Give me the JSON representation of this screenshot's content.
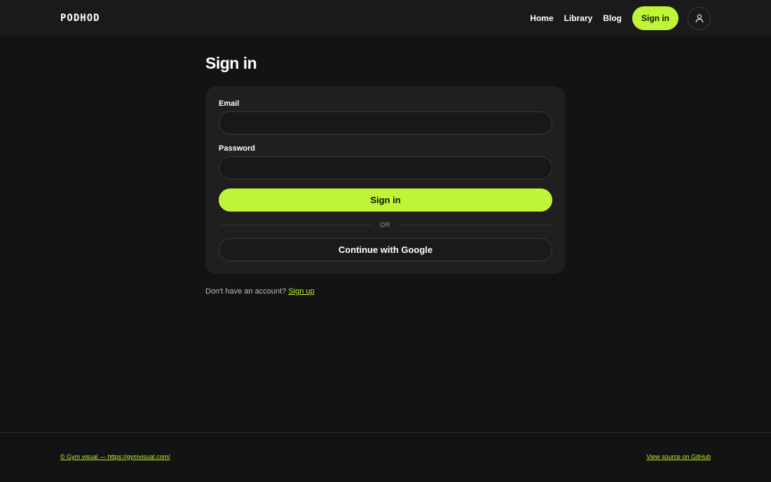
{
  "header": {
    "logo": "PODHOD",
    "nav": {
      "home": "Home",
      "library": "Library",
      "blog": "Blog",
      "sign_in": "Sign in"
    },
    "profile_icon": "user-icon"
  },
  "main": {
    "title": "Sign in",
    "form": {
      "email_label": "Email",
      "email_value": "",
      "password_label": "Password",
      "password_value": "",
      "submit_label": "Sign in",
      "divider": "OR",
      "google_label": "Continue with Google"
    },
    "signup_prompt": "Don't have an account?",
    "signup_link": "Sign up"
  },
  "footer": {
    "credit": "© Gym visual — https://gymvisual.com/",
    "source_link": "View source on GitHub"
  },
  "colors": {
    "background": "#131313",
    "surface": "#1f1f1f",
    "accent": "#bff536",
    "text": "#ffffff",
    "muted": "#bdbdbd"
  }
}
